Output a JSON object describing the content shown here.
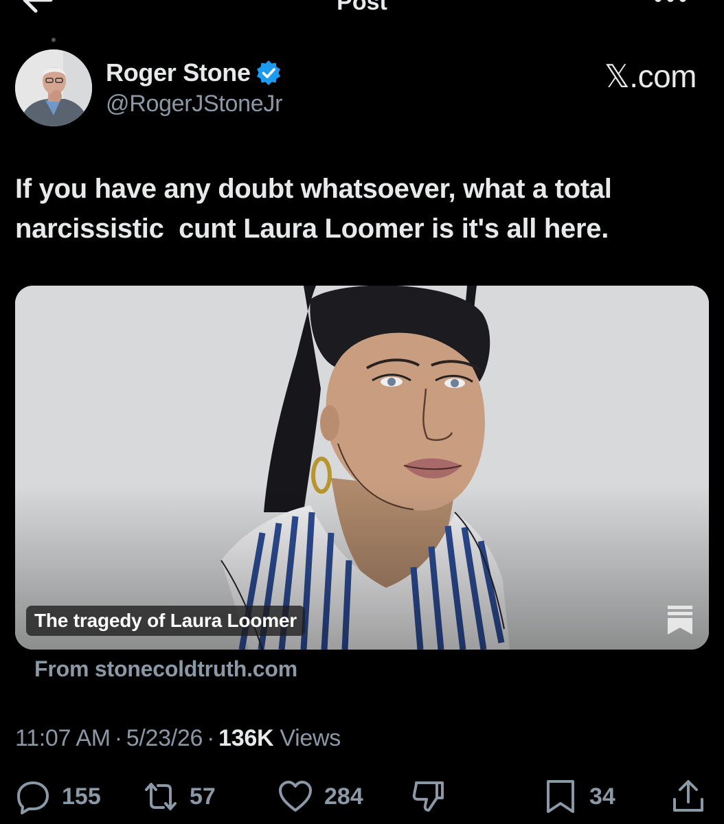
{
  "nav": {
    "title": "Post"
  },
  "author": {
    "display_name": "Roger Stone",
    "handle": "@RogerJStoneJr",
    "verified": true
  },
  "watermark": "𝕏.com",
  "post": {
    "text": "If you have any doubt whatsoever, what a total\nnarcissistic  cunt Laura Loomer is it's all here."
  },
  "card": {
    "title": "The tragedy of Laura Loomer",
    "source": "From stonecoldtruth.com"
  },
  "meta": {
    "time": "11:07 AM",
    "date": "5/23/26",
    "views_count": "136K",
    "views_label": "Views"
  },
  "actions": {
    "replies": "155",
    "reposts": "57",
    "likes": "284",
    "bookmarks": "34"
  },
  "icons": {
    "back": "arrow-left-icon",
    "more": "more-horizontal-icon",
    "verified": "verified-badge-icon",
    "card_bookmark": "bookmark-icon",
    "reply": "reply-icon",
    "repost": "repost-icon",
    "like": "heart-icon",
    "dislike": "dislike-icon",
    "bookmark": "bookmark-icon",
    "share": "share-icon"
  },
  "colors": {
    "background": "#000000",
    "text_primary": "#e7e9ea",
    "text_secondary": "#8b98a5",
    "verified": "#1d9bf0"
  }
}
